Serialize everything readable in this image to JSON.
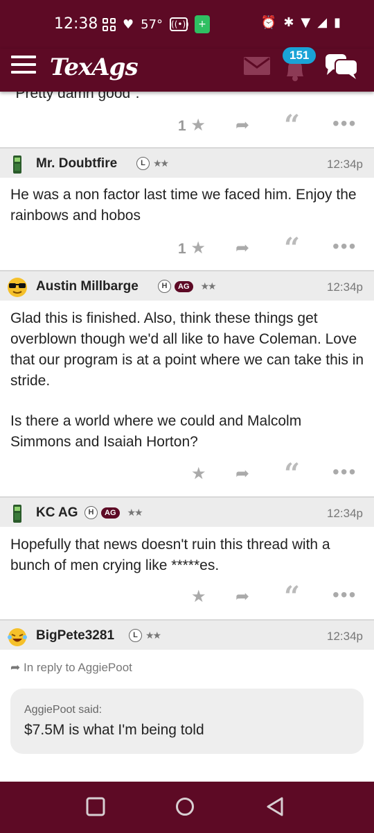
{
  "status_bar": {
    "time": "12:38",
    "temperature": "57°",
    "icons": [
      "grid-icon",
      "heart-icon",
      "radio-icon",
      "battery-saver-icon",
      "alarm-icon",
      "bluetooth-icon",
      "wifi-icon",
      "signal-icon",
      "battery-icon"
    ]
  },
  "header": {
    "logo": "TexAgs",
    "notification_count": "151",
    "icons": [
      "menu-icon",
      "mail-icon",
      "bell-icon",
      "chat-icon"
    ]
  },
  "colors": {
    "brand": "#5d0a25",
    "badge": "#1aa3d6",
    "muted": "#aaaaaa"
  },
  "posts": [
    {
      "body": "\"Pretty damn good\".",
      "likes": "1"
    },
    {
      "username": "Mr. Doubtfire",
      "badges": [
        "L"
      ],
      "stars": "★★",
      "time": "12:34p",
      "body": "He was a non factor last time we faced him. Enjoy the rainbows and hobos",
      "likes": "1"
    },
    {
      "username": "Austin Millbarge",
      "badges": [
        "H",
        "AG"
      ],
      "stars": "★★",
      "time": "12:34p",
      "body_p1": "Glad this is finished. Also, think these things get overblown though we'd all like to have Coleman. Love that our program is at a point where we can take this in stride.",
      "body_p2": "Is there a world where we could and Malcolm Simmons and Isaiah Horton?",
      "likes": ""
    },
    {
      "username": "KC AG",
      "badges": [
        "H",
        "AG"
      ],
      "stars": "★★",
      "time": "12:34p",
      "body": "Hopefully that news doesn't ruin this thread with a bunch of men crying like *****es.",
      "likes": ""
    },
    {
      "username": "BigPete3281",
      "badges": [
        "L"
      ],
      "stars": "★★",
      "time": "12:34p",
      "reply_note": "In reply to AggiePoot",
      "quote_author": "AggiePoot said:",
      "quote_text": "$7.5M is what I'm being told"
    }
  ],
  "navigation": [
    "recent-apps-button",
    "home-button",
    "back-button"
  ]
}
